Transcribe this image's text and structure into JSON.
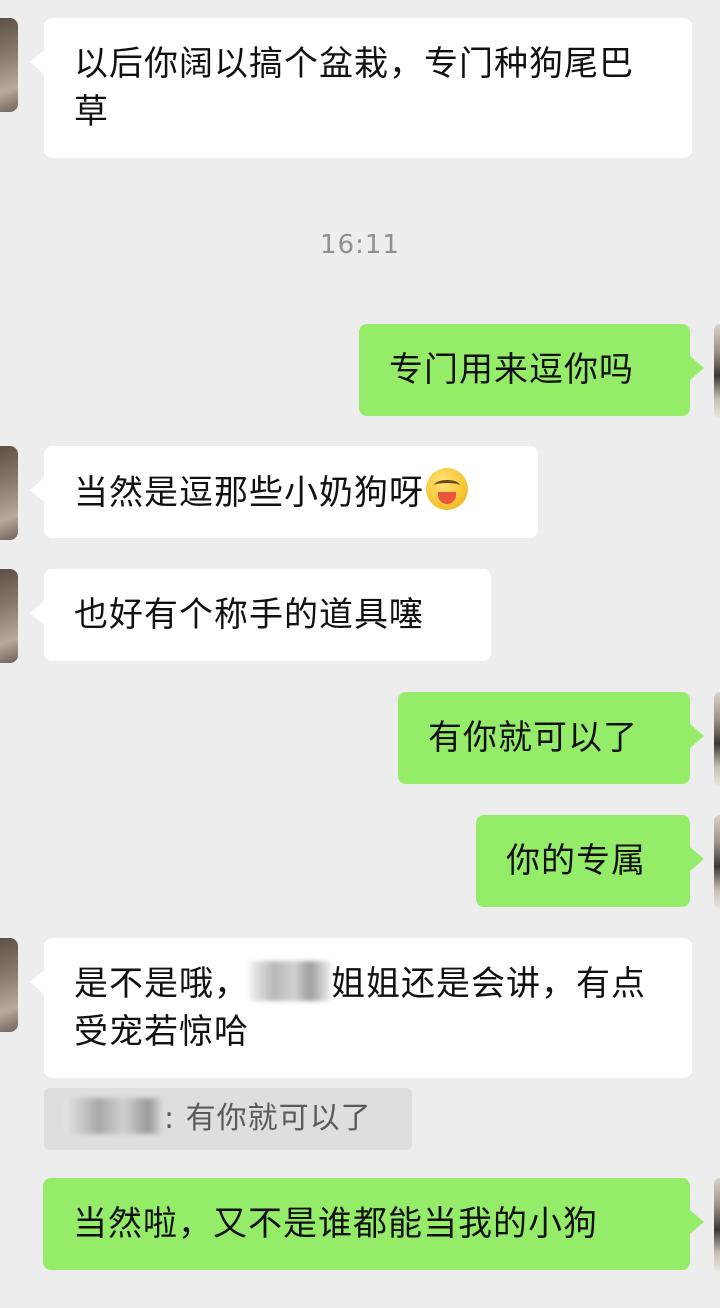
{
  "messages": [
    {
      "side": "left",
      "text": "以后你阔以搞个盆栽，专门种狗尾巴草"
    },
    {
      "side": "time",
      "text": "16:11"
    },
    {
      "side": "right",
      "text": "专门用来逗你吗"
    },
    {
      "side": "left",
      "text": "当然是逗那些小奶狗呀",
      "emoji": "smiling-face-emoji"
    },
    {
      "side": "left",
      "text": "也好有个称手的道具噻"
    },
    {
      "side": "right",
      "text": "有你就可以了"
    },
    {
      "side": "right",
      "text": "你的专属"
    },
    {
      "side": "left",
      "text_before": "是不是哦，",
      "text_after": "姐姐还是会讲，有点受宠若惊哈",
      "redacted": "blurred-name"
    },
    {
      "side": "quote",
      "separator": ":",
      "text": "有你就可以了"
    },
    {
      "side": "right",
      "text": "当然啦，又不是谁都能当我的小狗"
    }
  ],
  "colors": {
    "background": "#ededed",
    "incoming_bubble": "#ffffff",
    "outgoing_bubble": "#95ec69",
    "timestamp": "#8f8f8f",
    "quote_bg": "#dedede"
  }
}
